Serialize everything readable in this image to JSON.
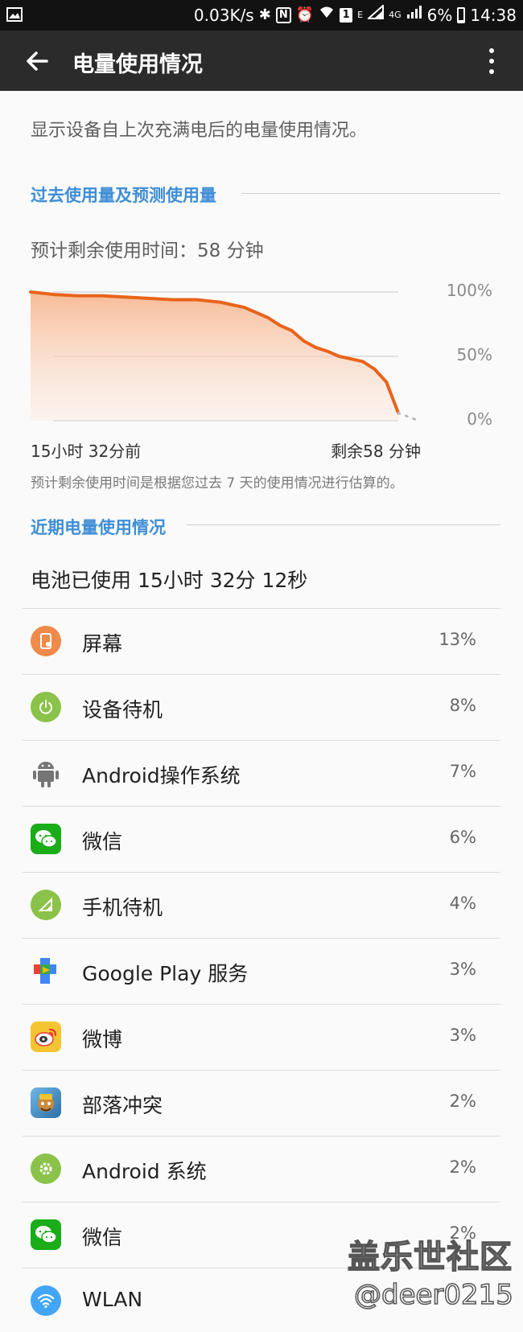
{
  "status_bar": {
    "speed": "0.03K/s",
    "sim_label": "1",
    "net_e": "E",
    "net_4g": "4G",
    "battery_pct": "6%",
    "time": "14:38"
  },
  "app_bar": {
    "title": "电量使用情况"
  },
  "description": "显示设备自上次充满电后的电量使用情况。",
  "history": {
    "heading": "过去使用量及预测使用量",
    "estimate_label": "预计剩余使用时间：58 分钟",
    "note": "预计剩余使用时间是根据您过去 7 天的使用情况进行估算的。"
  },
  "chart_data": {
    "type": "area",
    "y_ticks": [
      "100%",
      "50%",
      "0%"
    ],
    "ylim": [
      0,
      100
    ],
    "x_start_label": "15小时 32分前",
    "x_end_label": "剩余58 分钟",
    "x_hours_ago": [
      15.53,
      14.5,
      13.5,
      12.5,
      11.5,
      10.5,
      9.5,
      8.5,
      7.5,
      6.5,
      5.5,
      5.0,
      4.5,
      4.0,
      3.5,
      3.0,
      2.5,
      2.0,
      1.5,
      1.0,
      0.5,
      0.0
    ],
    "battery_level": [
      100,
      98,
      97,
      97,
      96,
      95,
      94,
      94,
      92,
      88,
      80,
      74,
      70,
      62,
      57,
      54,
      50,
      48,
      46,
      40,
      30,
      6
    ],
    "predicted_level": [
      6,
      0
    ],
    "line_color": "#e8641b",
    "fill_color": "#fbd9c4"
  },
  "recent": {
    "heading": "近期电量使用情况",
    "battery_used": "电池已使用 15小时 32分 12秒"
  },
  "usage_items": [
    {
      "label": "屏幕",
      "percent": "13%",
      "icon": "screen-icon",
      "color": "#ef8a4a"
    },
    {
      "label": "设备待机",
      "percent": "8%",
      "icon": "power-icon",
      "color": "#8bc34a"
    },
    {
      "label": "Android操作系统",
      "percent": "7%",
      "icon": "android-icon",
      "color": "#757575"
    },
    {
      "label": "微信",
      "percent": "6%",
      "icon": "wechat-icon",
      "color": "#1aad19"
    },
    {
      "label": "手机待机",
      "percent": "4%",
      "icon": "signal-icon",
      "color": "#8bc34a"
    },
    {
      "label": "Google Play 服务",
      "percent": "3%",
      "icon": "google-play-services-icon",
      "color": "#4caf50"
    },
    {
      "label": "微博",
      "percent": "3%",
      "icon": "weibo-icon",
      "color": "#f5c431"
    },
    {
      "label": "部落冲突",
      "percent": "2%",
      "icon": "clash-of-clans-icon",
      "color": "#c88a3a"
    },
    {
      "label": "Android 系统",
      "percent": "2%",
      "icon": "settings-gear-icon",
      "color": "#8bc34a"
    },
    {
      "label": "微信",
      "percent": "2%",
      "icon": "wechat-icon",
      "color": "#1aad19"
    },
    {
      "label": "WLAN",
      "percent": "",
      "icon": "wifi-icon",
      "color": "#42a5f5"
    }
  ],
  "watermark": {
    "line1": "盖乐世社区",
    "line2": "@deer0215"
  }
}
